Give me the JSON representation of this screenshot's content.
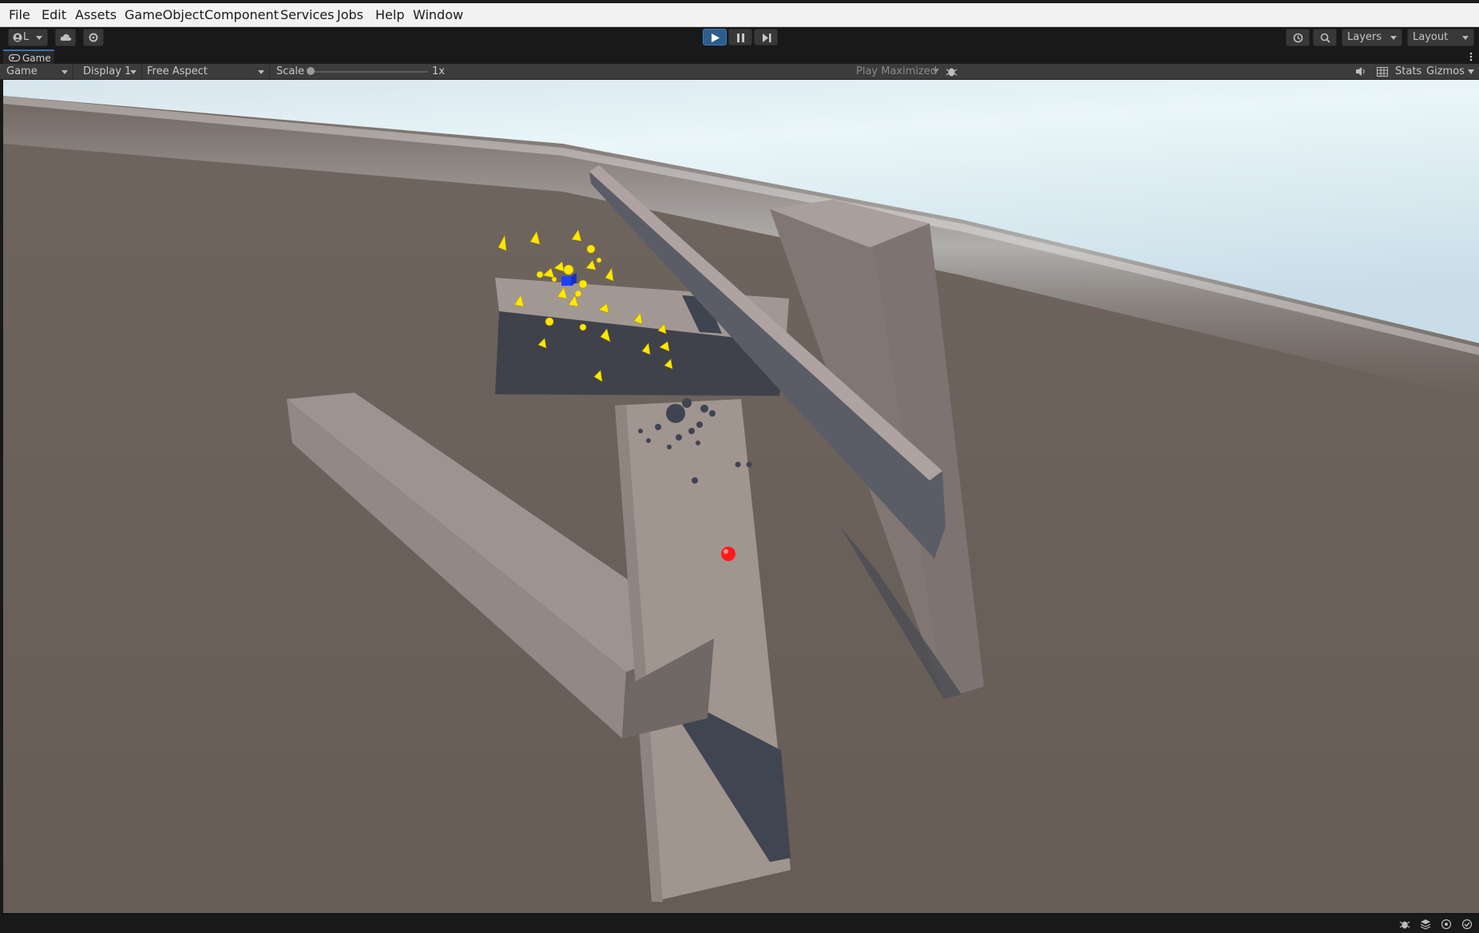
{
  "menu": [
    "File",
    "Edit",
    "Assets",
    "GameObject",
    "Component",
    "Services",
    "Jobs",
    "Help",
    "Window"
  ],
  "toolbar": {
    "account_label": "L",
    "layers_label": "Layers",
    "layout_label": "Layout",
    "play_state": "playing"
  },
  "game_tab": {
    "title": "Game"
  },
  "game_bar": {
    "view_mode": "Game",
    "display": "Display 1",
    "aspect": "Free Aspect",
    "scale_label": "Scale",
    "scale_value": "1x",
    "scale_fraction": 0,
    "play_maximized": "Play Maximized",
    "stats_label": "Stats",
    "gizmos_label": "Gizmos"
  },
  "icons": {
    "toolbar": [
      "account-icon",
      "cloud-icon",
      "settings-icon",
      "play-icon",
      "pause-icon",
      "step-icon",
      "history-icon",
      "search-icon"
    ],
    "game_bar": [
      "debug-bug-icon",
      "audio-icon",
      "grid-icon"
    ],
    "status": [
      "bug-icon",
      "stack-icon",
      "target-icon",
      "check-icon"
    ]
  },
  "colors": {
    "menubar_bg": "#f2f2f2",
    "editor_bg": "#191919",
    "accent_blue": "#2d5d8c",
    "ground": "#6a5f58",
    "sky_glow": "#e2f2f6",
    "block_light": "#a59a97",
    "block_shadow": "#3d3f46",
    "particles": "#ffe800",
    "ball": "#ff1a1a"
  }
}
